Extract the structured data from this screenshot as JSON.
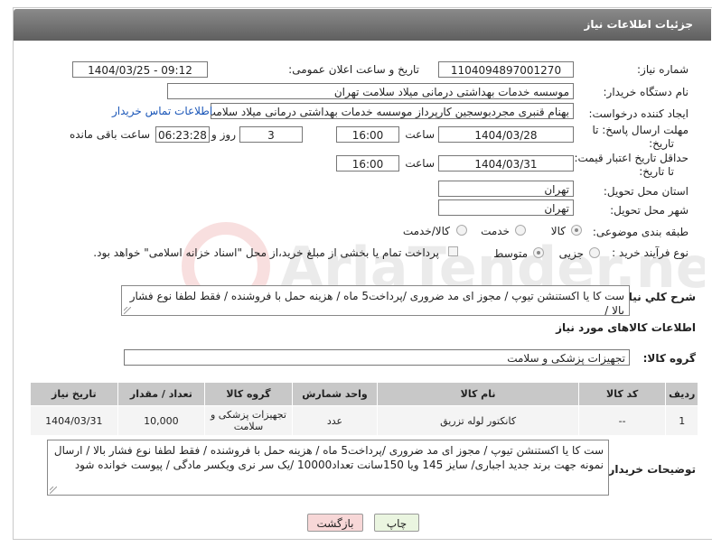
{
  "header": {
    "title": "جزئیات اطلاعات نیاز"
  },
  "watermark": {
    "text": "AriaTender.neT"
  },
  "fields": {
    "need_number_label": "شماره نیاز:",
    "need_number": "1104094897001270",
    "announce_label": "تاریخ و ساعت اعلان عمومی:",
    "announce_value": "1404/03/25 - 09:12",
    "buyer_org_label": "نام دستگاه خریدار:",
    "buyer_org": "موسسه خدمات بهداشتی درمانی میلاد سلامت تهران",
    "requester_label": "ایجاد کننده درخواست:",
    "requester": "بهنام قنبری مجردبوسجین کارپرداز موسسه خدمات بهداشتی درمانی میلاد سلامت تهران",
    "buyer_contact_link": "اطلاعات تماس خریدار",
    "deadline_label_1": "مهلت ارسال پاسخ: تا",
    "deadline_label_2": "تاریخ:",
    "deadline_date": "1404/03/28",
    "time_label": "ساعت",
    "deadline_time": "16:00",
    "days_value": "3",
    "days_label": "روز و",
    "remaining_time": "06:23:28",
    "remaining_label": "ساعت باقی مانده",
    "price_validity_label_1": "حداقل تاریخ اعتبار قیمت:",
    "price_validity_label_2": "تا تاریخ:",
    "price_validity_date": "1404/03/31",
    "price_validity_time": "16:00",
    "province_label": "استان محل تحویل:",
    "province": "تهران",
    "city_label": "شهر محل تحویل:",
    "city": "تهران",
    "category_label": "طبقه بندی موضوعی:",
    "category_options": [
      "کالا",
      "خدمت",
      "کالا/خدمت"
    ],
    "purchase_type_label": "نوع فرآیند خرید :",
    "purchase_type_options": [
      "جزیی",
      "متوسط"
    ],
    "payment_note": "پرداخت تمام یا بخشی از مبلغ خرید،از محل \"اسناد خزانه اسلامی\" خواهد بود.",
    "summary_label": "شرح کلي نياز:",
    "summary": "ست کا یا اکستنشن تیوپ  / مجوز ای مد ضروری /پرداخت5 ماه / هزینه حمل با فروشنده /  فقط لطفا نوع فشار بالا /",
    "goods_info_title": "اطلاعات کالاهای مورد نیاز",
    "goods_group_label": "گروه کالا:",
    "goods_group": "تجهیزات پزشکی و سلامت"
  },
  "table": {
    "headers": [
      "ردیف",
      "کد کالا",
      "نام کالا",
      "واحد شمارش",
      "گروه کالا",
      "تعداد / مقدار",
      "تاریخ نیاز"
    ],
    "rows": [
      [
        "1",
        "--",
        "کانکتور لوله تزریق",
        "عدد",
        "تجهیزات پزشکی و سلامت",
        "10,000",
        "1404/03/31"
      ]
    ]
  },
  "buyer_notes": {
    "label": "توضیحات خریدار:",
    "text": "ست کا یا اکستنشن تیوپ  / مجوز ای مد ضروری /پرداخت5 ماه / هزینه حمل با فروشنده /  فقط لطفا نوع فشار بالا / ارسال نمونه جهت برند جدید اجباری/ سایز 145 ویا 150سانت تعداد10000 /یک سر نری ویکسر مادگی / پیوست خوانده شود"
  },
  "buttons": {
    "print": "چاپ",
    "back": "بازگشت"
  },
  "colors": {
    "header": "#6f6f6f",
    "back_button": "#f7d7d7",
    "print_button": "#eaf5e0",
    "link": "#1a56b8"
  }
}
